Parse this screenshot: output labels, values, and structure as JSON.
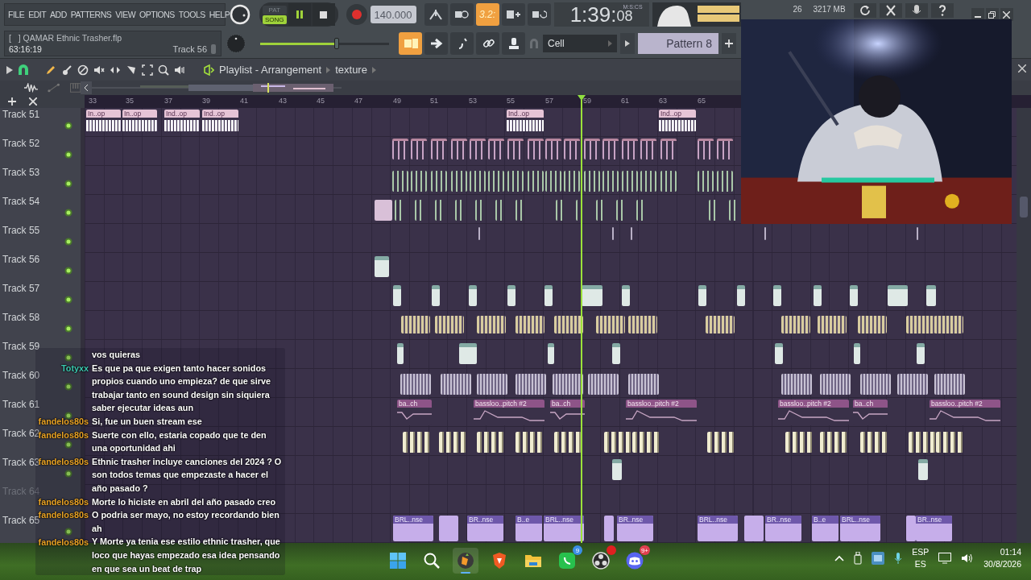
{
  "menu": [
    "FILE",
    "EDIT",
    "ADD",
    "PATTERNS",
    "VIEW",
    "OPTIONS",
    "TOOLS",
    "HELP"
  ],
  "transport": {
    "modes": [
      {
        "label": "PAT",
        "selected": false
      },
      {
        "label": "SONG",
        "selected": true
      }
    ],
    "playing": true,
    "tempo": "140.000"
  },
  "snap_toggles": [
    {
      "selected": false
    },
    {
      "selected": false
    },
    {
      "selected": true,
      "label": "3.2:"
    },
    {
      "selected": false
    },
    {
      "selected": false
    }
  ],
  "clock": {
    "time": "1:39:",
    "centiseconds": "08",
    "format": "M:S:CS"
  },
  "system": {
    "cpu": "26",
    "memory": "3217 MB"
  },
  "song": {
    "file": "[   ] QAMAR Ethnic Trasher.flp",
    "position": "63:16:19",
    "hint": "Track 56"
  },
  "master_volume": {
    "level": 0.6
  },
  "edit_toggles": [
    {
      "selected": true
    },
    {
      "selected": false
    },
    {
      "selected": false
    },
    {
      "selected": false
    },
    {
      "selected": false
    }
  ],
  "snap": "Cell",
  "pattern": "Pattern 8",
  "playlist": {
    "title": "Playlist - Arrangement",
    "pattern": "texture",
    "ruler": [
      "33",
      "35",
      "37",
      "39",
      "41",
      "43",
      "45",
      "47",
      "49",
      "51",
      "53",
      "55",
      "57",
      "59",
      "61",
      "63",
      "65"
    ],
    "tracks": [
      {
        "name": "Track 51",
        "enabled": true,
        "clips": [
          "In..op",
          "In..op",
          "Ind..op",
          "Ind..op",
          "Ind..op",
          "Ind..op"
        ]
      },
      {
        "name": "Track 52",
        "enabled": true
      },
      {
        "name": "Track 53",
        "enabled": true
      },
      {
        "name": "Track 54",
        "enabled": true
      },
      {
        "name": "Track 55",
        "enabled": true
      },
      {
        "name": "Track 56",
        "enabled": true
      },
      {
        "name": "Track 57",
        "enabled": true
      },
      {
        "name": "Track 58",
        "enabled": true
      },
      {
        "name": "Track 59",
        "enabled": true
      },
      {
        "name": "Track 60",
        "enabled": true
      },
      {
        "name": "Track 61",
        "enabled": true,
        "clips": [
          "ba..ch",
          "bassloo..pitch #2",
          "ba..ch",
          "bassloo..pitch #2",
          "bassloo..pitch #2",
          "ba..ch",
          "bassloo..pitch #2"
        ]
      },
      {
        "name": "Track 62",
        "enabled": true
      },
      {
        "name": "Track 63",
        "enabled": true
      },
      {
        "name": "Track 64",
        "enabled": false
      },
      {
        "name": "Track 65",
        "enabled": true,
        "clips": [
          "BRL..nse",
          "BR..nse",
          "B..e",
          "BRL..nse",
          "BR..nse",
          "BRL..nse",
          "BR..nse",
          "B..e",
          "BRL..nse",
          "BR..nse"
        ]
      }
    ]
  },
  "chat": [
    {
      "text": "vos quieras"
    },
    {
      "user": "Totyxx",
      "color": "#3cc8b0",
      "text": "Es que pa que exigen tanto hacer sonidos propios cuando uno empieza? de que sirve trabajar tanto en sound design sin siquiera saber ejecutar ideas aun"
    },
    {
      "user": "fandelos80s",
      "color": "#e8a224",
      "text": "Si, fue un buen stream ese"
    },
    {
      "user": "fandelos80s",
      "color": "#e8a224",
      "text": "Suerte con ello, estaria copado que te den una oportunidad ahi"
    },
    {
      "user": "fandelos80s",
      "color": "#e8a224",
      "text": "Ethnic trasher incluye canciones del 2024 ? O son todos temas que empezaste a hacer el año pasado ?"
    },
    {
      "user": "fandelos80s",
      "color": "#e8a224",
      "text": "Morte lo hiciste en abril del año pasado creo"
    },
    {
      "user": "fandelos80s",
      "color": "#e8a224",
      "text": "O podria ser mayo, no estoy recordando bien ah"
    },
    {
      "user": "fandelos80s",
      "color": "#e8a224",
      "text": "Y Morte ya tenia ese estilo ethnic trasher, que loco que hayas empezado esa idea pensando en que sea un beat de trap"
    }
  ],
  "taskbar": {
    "apps": [
      {
        "kind": "start",
        "active": false
      },
      {
        "kind": "search",
        "active": false
      },
      {
        "kind": "daw",
        "active": true
      },
      {
        "kind": "browser",
        "active": false
      },
      {
        "kind": "folder",
        "active": false
      },
      {
        "kind": "messenger",
        "active": false,
        "badge": "9"
      },
      {
        "kind": "recorder",
        "active": false,
        "alert": true
      },
      {
        "kind": "voice",
        "active": false,
        "badge": "9+"
      }
    ],
    "language": "ESP",
    "keyboard": "ES",
    "time": "01:14",
    "date": "30/8/2026"
  }
}
